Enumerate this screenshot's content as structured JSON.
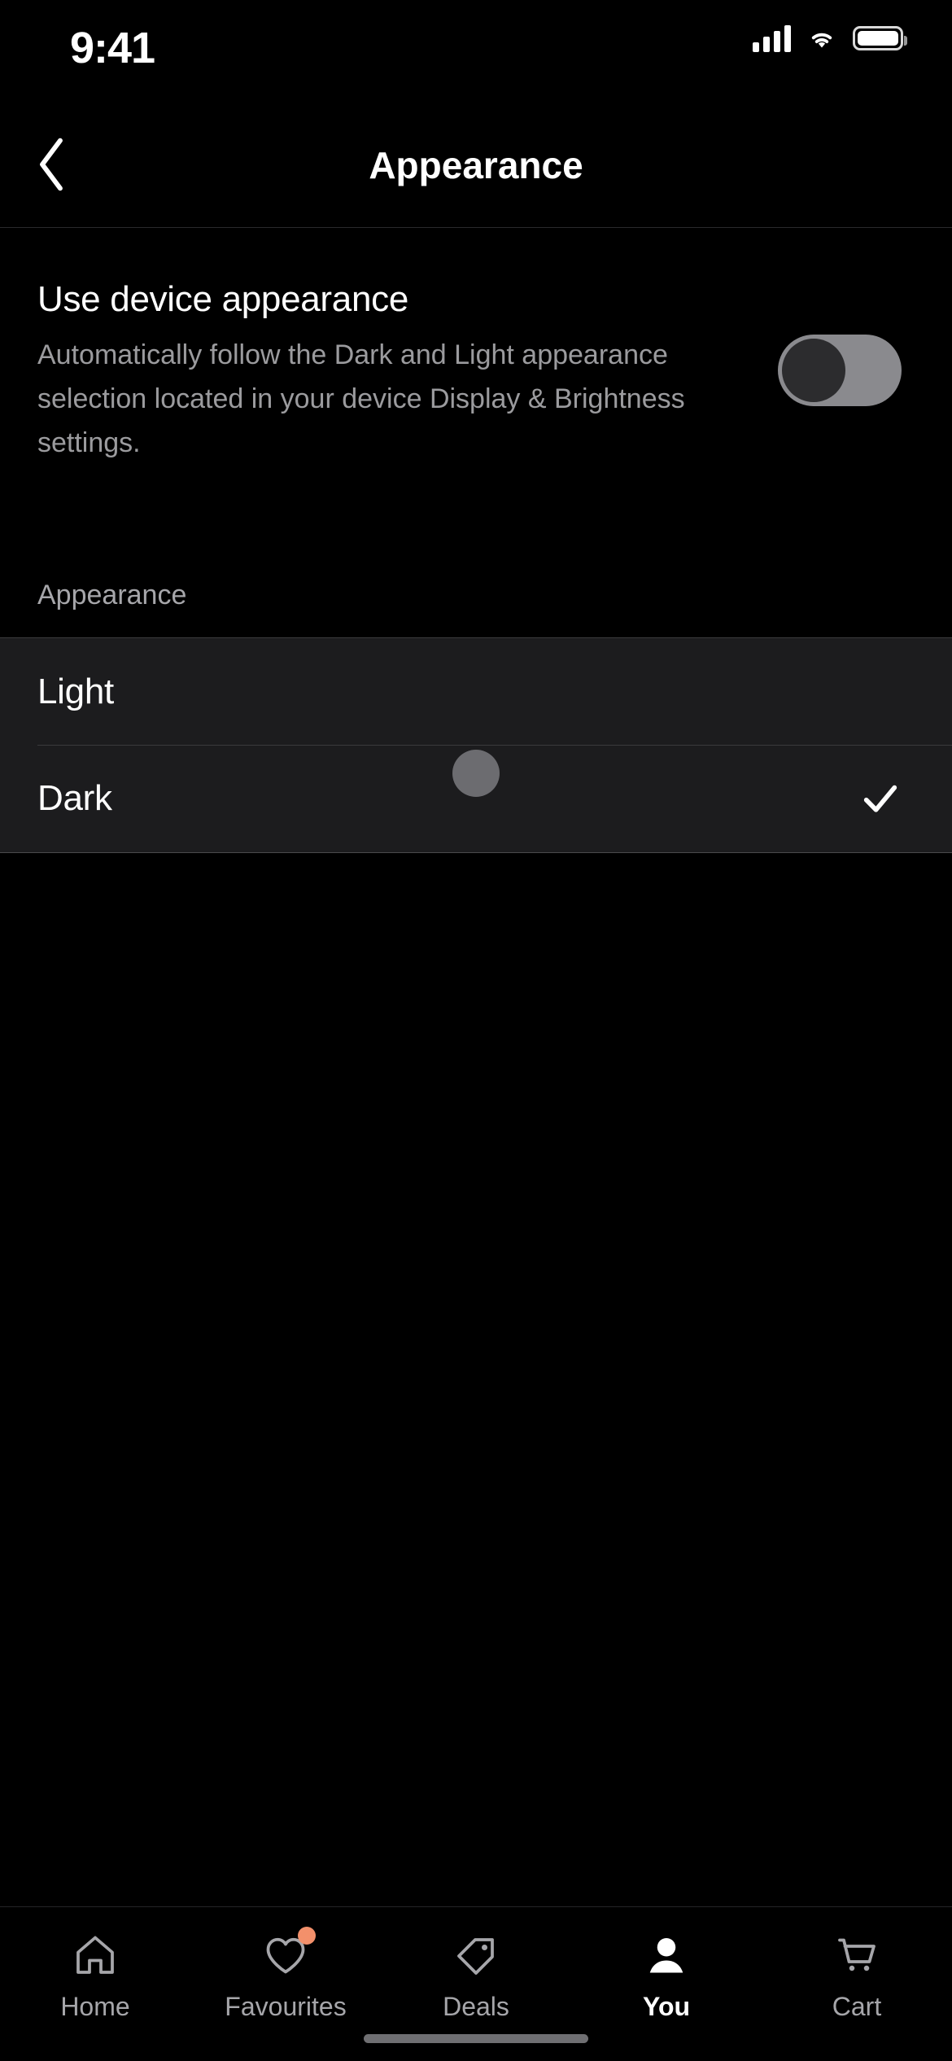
{
  "status_bar": {
    "time": "9:41",
    "cellular_icon": "signal-bars-icon",
    "wifi_icon": "wifi-icon",
    "battery_icon": "battery-icon"
  },
  "header": {
    "back_icon": "chevron-left-icon",
    "title": "Appearance"
  },
  "device_appearance": {
    "title": "Use device appearance",
    "description": "Automatically follow the Dark and Light appearance selection located in your device Display & Brightness settings.",
    "toggle": {
      "state": "off",
      "track_color": "#8a8a8e",
      "knob_color": "#2c2c2e"
    }
  },
  "appearance_section": {
    "label": "Appearance",
    "options": [
      {
        "label": "Light",
        "selected": false,
        "check_icon": ""
      },
      {
        "label": "Dark",
        "selected": true,
        "check_icon": "checkmark-icon"
      }
    ]
  },
  "cursor": {
    "name": "touch-cursor",
    "color": "#6c6c70"
  },
  "tab_bar": {
    "items": [
      {
        "label": "Home",
        "icon": "home-icon",
        "active": false,
        "badge": false
      },
      {
        "label": "Favourites",
        "icon": "heart-icon",
        "active": false,
        "badge": true
      },
      {
        "label": "Deals",
        "icon": "tag-icon",
        "active": false,
        "badge": false
      },
      {
        "label": "You",
        "icon": "person-icon",
        "active": true,
        "badge": false
      },
      {
        "label": "Cart",
        "icon": "shopping-cart-icon",
        "active": false,
        "badge": false
      }
    ],
    "badge_color": "#f3906b",
    "active_color": "#ffffff",
    "inactive_color": "#a6a6aa"
  },
  "home_indicator": "home-indicator"
}
